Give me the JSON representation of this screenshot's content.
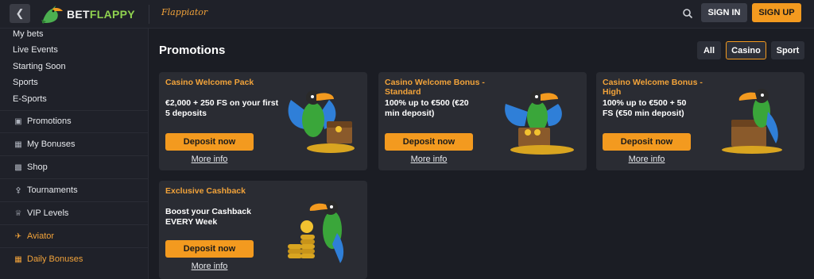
{
  "header": {
    "back_icon": "chevron-left-icon",
    "logo_text_a": "BET",
    "logo_text_b": "FLAPPY",
    "flappiator": "Flappiator",
    "signin": "SIGN IN",
    "signup": "SIGN UP"
  },
  "sidebar": {
    "links": [
      "My bets",
      "Live Events",
      "Starting Soon",
      "Sports",
      "E-Sports"
    ],
    "items": [
      {
        "label": "Promotions",
        "icon": "gift-icon"
      },
      {
        "label": "My Bonuses",
        "icon": "bonus-icon"
      },
      {
        "label": "Shop",
        "icon": "shop-icon"
      },
      {
        "label": "Tournaments",
        "icon": "trophy-icon"
      },
      {
        "label": "VIP Levels",
        "icon": "crown-icon"
      },
      {
        "label": "Aviator",
        "icon": "plane-icon"
      },
      {
        "label": "Daily Bonuses",
        "icon": "calendar-icon"
      }
    ]
  },
  "main": {
    "title": "Promotions",
    "filters": [
      "All",
      "Casino",
      "Sport"
    ],
    "active_filter": "Casino",
    "cards": [
      {
        "title": "Casino Welcome Pack",
        "desc": "€2,000 + 250 FS on your first 5 deposits",
        "button": "Deposit now",
        "link": "More info"
      },
      {
        "title": "Casino Welcome Bonus - Standard",
        "desc": "100% up to €500 (€20 min deposit)",
        "button": "Deposit now",
        "link": "More info"
      },
      {
        "title": "Casino Welcome Bonus - High",
        "desc": "100% up to €500 + 50 FS (€50 min deposit)",
        "button": "Deposit now",
        "link": "More info"
      },
      {
        "title": "Exclusive Cashback",
        "desc": "Boost your Cashback EVERY Week",
        "button": "Deposit now",
        "link": "More info"
      }
    ]
  },
  "colors": {
    "accent": "#f39a1f",
    "background": "#1b1d24",
    "card": "#2a2c33"
  }
}
